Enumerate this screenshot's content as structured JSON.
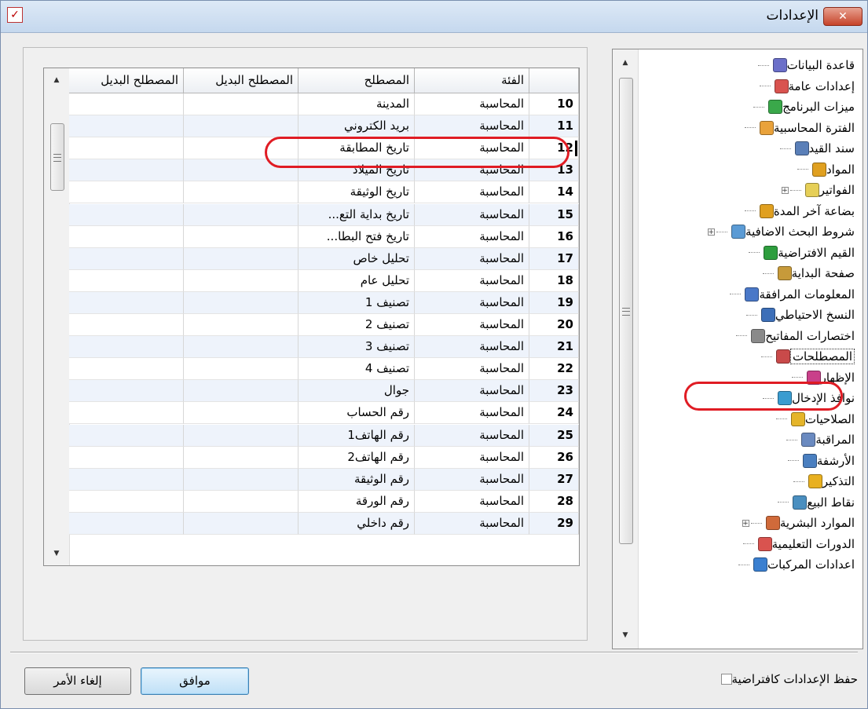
{
  "window": {
    "title": "الإعدادات",
    "close_label": "✕"
  },
  "tree": {
    "items": [
      {
        "label": "قاعدة البيانات",
        "icon": "database-icon",
        "color": "#6b6fc9",
        "expandable": false
      },
      {
        "label": "إعدادات عامة",
        "icon": "checklist-icon",
        "color": "#d9534f",
        "expandable": false
      },
      {
        "label": "ميزات البرنامج",
        "icon": "cubes-icon",
        "color": "#3aa84a",
        "expandable": false
      },
      {
        "label": "الفترة المحاسبية",
        "icon": "calendar-icon",
        "color": "#e9a23b",
        "expandable": false
      },
      {
        "label": "سند القيد",
        "icon": "document-icon",
        "color": "#5a7fb8",
        "expandable": false
      },
      {
        "label": "المواد",
        "icon": "box-icon",
        "color": "#e0a020",
        "expandable": false
      },
      {
        "label": "الفواتير",
        "icon": "invoice-icon",
        "color": "#e6cf57",
        "expandable": true
      },
      {
        "label": "بضاعة آخر المدة",
        "icon": "box-icon",
        "color": "#e0a020",
        "expandable": false
      },
      {
        "label": "شروط البحث الاضافية",
        "icon": "search-icon",
        "color": "#5b9bd5",
        "expandable": true
      },
      {
        "label": "القيم الافتراضية",
        "icon": "check-circle-icon",
        "color": "#2e9e3e",
        "expandable": false
      },
      {
        "label": "صفحة البداية",
        "icon": "palette-icon",
        "color": "#c79a3a",
        "expandable": false
      },
      {
        "label": "المعلومات المرافقة",
        "icon": "info-icon",
        "color": "#4a78c8",
        "expandable": false
      },
      {
        "label": "النسخ الاحتياطي",
        "icon": "backup-icon",
        "color": "#3d6fb8",
        "expandable": false
      },
      {
        "label": "اختصارات المفاتيح",
        "icon": "keyboard-icon",
        "color": "#8a8a8a",
        "expandable": false
      },
      {
        "label": "المصطلحات",
        "icon": "terms-icon",
        "color": "#c94a4a",
        "expandable": false,
        "selected": true
      },
      {
        "label": "الإظهار",
        "icon": "display-icon",
        "color": "#c9408a",
        "expandable": false
      },
      {
        "label": "نوافذ الإدخال",
        "icon": "pencil-icon",
        "color": "#3a9cd0",
        "expandable": false
      },
      {
        "label": "الصلاحيات",
        "icon": "lock-icon",
        "color": "#e5b52a",
        "expandable": false
      },
      {
        "label": "المراقبة",
        "icon": "monitor-icon",
        "color": "#6a8ac0",
        "expandable": false
      },
      {
        "label": "الأرشفة",
        "icon": "paperclip-icon",
        "color": "#4a7fc0",
        "expandable": false
      },
      {
        "label": "التذكير",
        "icon": "bell-icon",
        "color": "#e8b020",
        "expandable": false
      },
      {
        "label": "نقاط البيع",
        "icon": "pos-icon",
        "color": "#4a8fc0",
        "expandable": false
      },
      {
        "label": "الموارد البشرية",
        "icon": "person-icon",
        "color": "#d06a3a",
        "expandable": true
      },
      {
        "label": "الدورات التعليمية",
        "icon": "checklist-icon",
        "color": "#d9534f",
        "expandable": false
      },
      {
        "label": "اعدادات المركبات",
        "icon": "car-icon",
        "color": "#3a7fd0",
        "expandable": false
      }
    ]
  },
  "table": {
    "headers": {
      "category": "الفئة",
      "term": "المصطلح",
      "alt1": "المصطلح البديل",
      "alt2": "المصطلح البديل"
    },
    "rows": [
      {
        "num": "10",
        "category": "المحاسبة",
        "term": "المدينة"
      },
      {
        "num": "11",
        "category": "المحاسبة",
        "term": "بريد الكتروني"
      },
      {
        "num": "12",
        "category": "المحاسبة",
        "term": "تاريخ المطابقة",
        "current": true
      },
      {
        "num": "13",
        "category": "المحاسبة",
        "term": "تاريخ الميلاد"
      },
      {
        "num": "14",
        "category": "المحاسبة",
        "term": "تاريخ الوثيقة"
      },
      {
        "num": "15",
        "category": "المحاسبة",
        "term": "تاريخ بداية التع..."
      },
      {
        "num": "16",
        "category": "المحاسبة",
        "term": "تاريخ فتح البطا..."
      },
      {
        "num": "17",
        "category": "المحاسبة",
        "term": "تحليل خاص"
      },
      {
        "num": "18",
        "category": "المحاسبة",
        "term": "تحليل عام"
      },
      {
        "num": "19",
        "category": "المحاسبة",
        "term": "تصنيف 1"
      },
      {
        "num": "20",
        "category": "المحاسبة",
        "term": "تصنيف 2"
      },
      {
        "num": "21",
        "category": "المحاسبة",
        "term": "تصنيف 3"
      },
      {
        "num": "22",
        "category": "المحاسبة",
        "term": "تصنيف 4"
      },
      {
        "num": "23",
        "category": "المحاسبة",
        "term": "جوال"
      },
      {
        "num": "24",
        "category": "المحاسبة",
        "term": "رقم الحساب"
      },
      {
        "num": "25",
        "category": "المحاسبة",
        "term": "رقم الهاتف1"
      },
      {
        "num": "26",
        "category": "المحاسبة",
        "term": "رقم الهاتف2"
      },
      {
        "num": "27",
        "category": "المحاسبة",
        "term": "رقم الوثيقة"
      },
      {
        "num": "28",
        "category": "المحاسبة",
        "term": "رقم الورقة"
      },
      {
        "num": "29",
        "category": "المحاسبة",
        "term": "رقم داخلي"
      }
    ]
  },
  "footer": {
    "save_default_label": "حفظ الإعدادات كافتراضية",
    "ok_label": "موافق",
    "cancel_label": "إلغاء الأمر"
  },
  "colors": {
    "highlight": "#e01c24",
    "row_alt": "#eef3fb",
    "title_gradient_top": "#dde9f6"
  }
}
